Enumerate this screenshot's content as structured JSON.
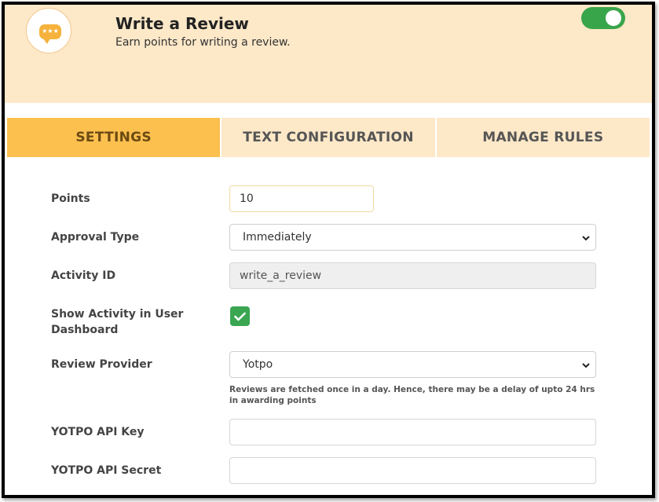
{
  "header": {
    "title": "Write a Review",
    "subtitle": "Earn points for writing a review.",
    "icon": "review-bubble-icon",
    "enabled": true,
    "colors": {
      "background": "#fde8c8",
      "toggle": "#39a54a",
      "badge": "#f6b23c"
    }
  },
  "tabs": [
    {
      "label": "SETTINGS",
      "active": true
    },
    {
      "label": "TEXT CONFIGURATION",
      "active": false
    },
    {
      "label": "MANAGE RULES",
      "active": false
    }
  ],
  "form": {
    "points": {
      "label": "Points",
      "value": "10"
    },
    "approval_type": {
      "label": "Approval Type",
      "selected": "Immediately"
    },
    "activity_id": {
      "label": "Activity ID",
      "value": "write_a_review"
    },
    "show_activity": {
      "label": "Show Activity in User Dashboard",
      "checked": true
    },
    "review_provider": {
      "label": "Review Provider",
      "selected": "Yotpo",
      "note": "Reviews are fetched once in a day. Hence, there may be a delay of upto 24 hrs in awarding points"
    },
    "api_key": {
      "label": "YOTPO API Key",
      "value": ""
    },
    "api_secret": {
      "label": "YOTPO API Secret",
      "value": ""
    }
  }
}
